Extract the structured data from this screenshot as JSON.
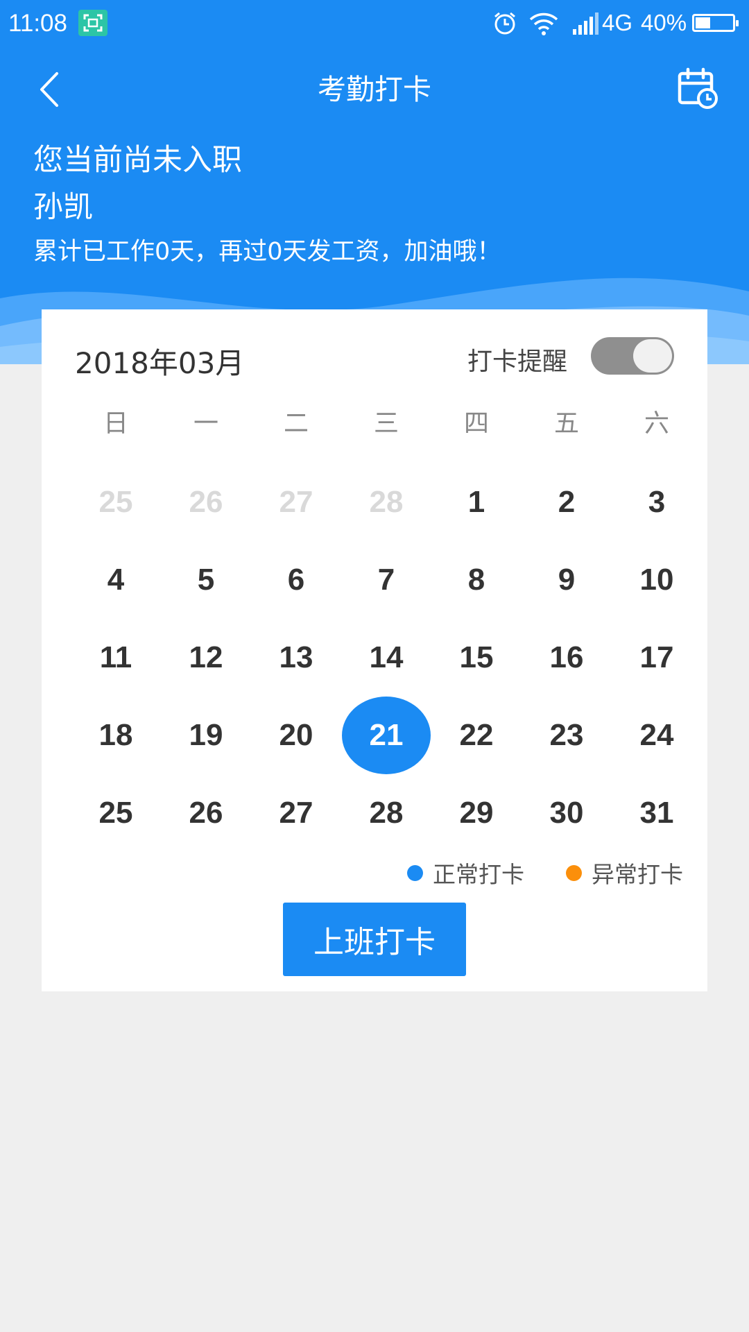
{
  "status_bar": {
    "time": "11:08",
    "network": "4G",
    "battery": "40%",
    "battery_level": 0.4
  },
  "nav": {
    "title": "考勤打卡"
  },
  "user": {
    "status": "您当前尚未入职",
    "name": "孙凯",
    "summary": "累计已工作0天，再过0天发工资，加油哦！"
  },
  "calendar": {
    "month_title": "2018年03月",
    "reminder_label": "打卡提醒",
    "reminder_on": true,
    "weekdays": [
      "日",
      "一",
      "二",
      "三",
      "四",
      "五",
      "六"
    ],
    "days": [
      {
        "label": "25",
        "state": "muted"
      },
      {
        "label": "26",
        "state": "muted"
      },
      {
        "label": "27",
        "state": "muted"
      },
      {
        "label": "28",
        "state": "muted"
      },
      {
        "label": "1",
        "state": "normal"
      },
      {
        "label": "2",
        "state": "normal"
      },
      {
        "label": "3",
        "state": "normal"
      },
      {
        "label": "4",
        "state": "normal"
      },
      {
        "label": "5",
        "state": "normal"
      },
      {
        "label": "6",
        "state": "normal"
      },
      {
        "label": "7",
        "state": "normal"
      },
      {
        "label": "8",
        "state": "normal"
      },
      {
        "label": "9",
        "state": "normal"
      },
      {
        "label": "10",
        "state": "normal"
      },
      {
        "label": "11",
        "state": "normal"
      },
      {
        "label": "12",
        "state": "normal"
      },
      {
        "label": "13",
        "state": "normal"
      },
      {
        "label": "14",
        "state": "normal"
      },
      {
        "label": "15",
        "state": "normal"
      },
      {
        "label": "16",
        "state": "normal"
      },
      {
        "label": "17",
        "state": "normal"
      },
      {
        "label": "18",
        "state": "normal"
      },
      {
        "label": "19",
        "state": "normal"
      },
      {
        "label": "20",
        "state": "normal"
      },
      {
        "label": "21",
        "state": "selected"
      },
      {
        "label": "22",
        "state": "normal"
      },
      {
        "label": "23",
        "state": "normal"
      },
      {
        "label": "24",
        "state": "normal"
      },
      {
        "label": "25",
        "state": "normal"
      },
      {
        "label": "26",
        "state": "normal"
      },
      {
        "label": "27",
        "state": "normal"
      },
      {
        "label": "28",
        "state": "normal"
      },
      {
        "label": "29",
        "state": "normal"
      },
      {
        "label": "30",
        "state": "normal"
      },
      {
        "label": "31",
        "state": "normal"
      }
    ]
  },
  "legend": {
    "normal_label": "正常打卡",
    "normal_color": "#1b8bf3",
    "abnormal_label": "异常打卡",
    "abnormal_color": "#fb8f0b"
  },
  "checkin": {
    "button_label": "上班打卡"
  },
  "colors": {
    "primary": "#1b8bf3",
    "background": "#efefef"
  },
  "icons": {
    "back": "chevron-left-icon",
    "calendar": "calendar-clock-icon",
    "scan": "scan-icon",
    "alarm": "alarm-icon",
    "wifi": "wifi-icon",
    "signal": "signal-icon",
    "battery": "battery-icon"
  }
}
